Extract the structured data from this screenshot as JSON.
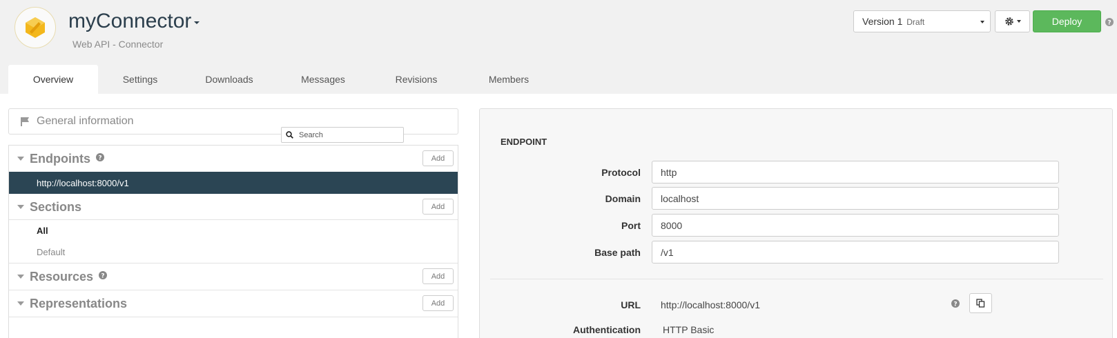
{
  "header": {
    "title": "myConnector",
    "subtitle": "Web API - Connector",
    "version_label": "Version 1",
    "version_status": "Draft",
    "deploy_label": "Deploy"
  },
  "tabs": [
    {
      "label": "Overview",
      "active": true
    },
    {
      "label": "Settings"
    },
    {
      "label": "Downloads"
    },
    {
      "label": "Messages"
    },
    {
      "label": "Revisions"
    },
    {
      "label": "Members"
    }
  ],
  "left": {
    "general_info": "General information",
    "endpoints": {
      "label": "Endpoints",
      "add": "Add",
      "items": [
        "http://localhost:8000/v1"
      ]
    },
    "sections": {
      "label": "Sections",
      "add": "Add",
      "items": [
        "All",
        "Default"
      ]
    },
    "resources": {
      "label": "Resources",
      "add": "Add",
      "search_placeholder": "Search"
    },
    "representations": {
      "label": "Representations",
      "add": "Add"
    }
  },
  "endpoint": {
    "title": "ENDPOINT",
    "fields": [
      {
        "label": "Protocol",
        "value": "http"
      },
      {
        "label": "Domain",
        "value": "localhost"
      },
      {
        "label": "Port",
        "value": "8000"
      },
      {
        "label": "Base path",
        "value": "/v1"
      }
    ],
    "url_label": "URL",
    "url_value": "http://localhost:8000/v1",
    "auth_label": "Authentication",
    "auth_value": "HTTP Basic"
  },
  "colors": {
    "accent_dark": "#2b4554",
    "deploy_green": "#5cb85c",
    "logo_yellow": "#f3b71c"
  }
}
